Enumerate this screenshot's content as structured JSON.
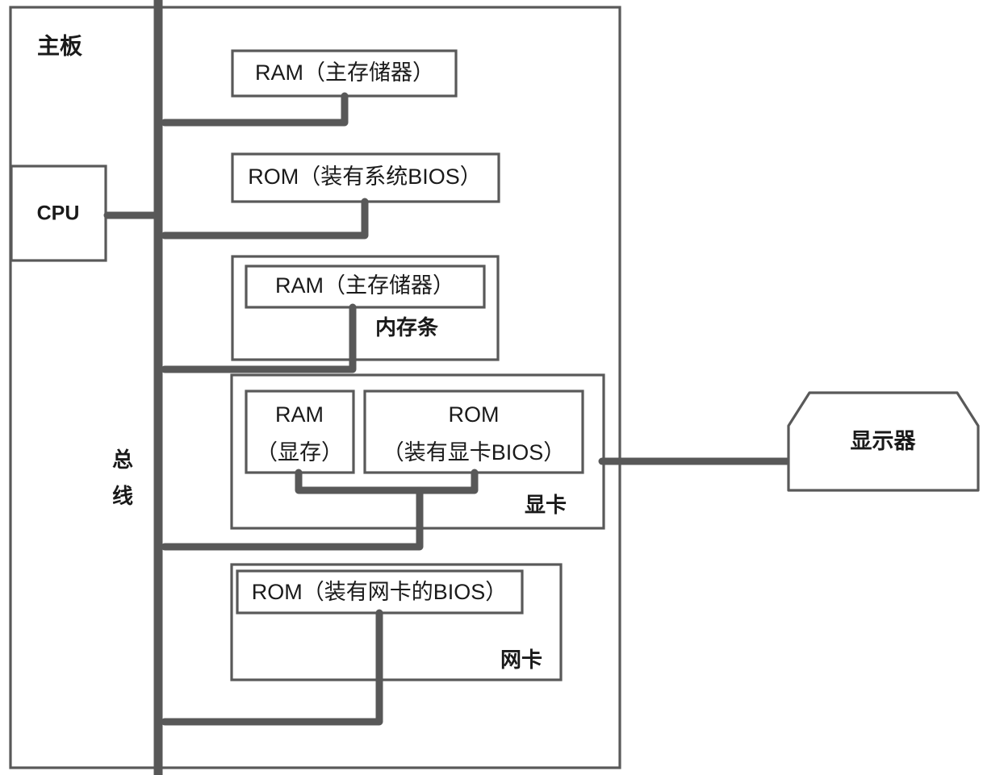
{
  "diagram": {
    "title_motherboard": "主板",
    "bus_label_chars": [
      "总",
      "线"
    ],
    "colors": {
      "line": "#585858",
      "box_border": "#595959",
      "text": "#1a1a1a",
      "background": "#ffffff"
    },
    "nodes": {
      "cpu": {
        "label": "CPU"
      },
      "ram_main_top": {
        "label": "RAM（主存储器）"
      },
      "rom_system_bios": {
        "label": "ROM（装有系统BIOS）"
      },
      "memory_module": {
        "label": "内存条",
        "inner_ram": {
          "label": "RAM（主存储器）"
        }
      },
      "graphics_card": {
        "label": "显卡",
        "inner_ram": {
          "label_line1": "RAM",
          "label_line2": "（显存）"
        },
        "inner_rom": {
          "label_line1": "ROM",
          "label_line2": "（装有显卡BIOS）"
        }
      },
      "network_card": {
        "label": "网卡",
        "inner_rom": {
          "label": "ROM（装有网卡的BIOS）"
        }
      },
      "monitor": {
        "label": "显示器"
      }
    },
    "connections": [
      {
        "from": "cpu",
        "to": "bus"
      },
      {
        "from": "ram_main_top",
        "to": "bus"
      },
      {
        "from": "rom_system_bios",
        "to": "bus"
      },
      {
        "from": "memory_module_ram",
        "to": "bus"
      },
      {
        "from": "graphics_card_ram",
        "to": "graphics_card_junction"
      },
      {
        "from": "graphics_card_rom",
        "to": "graphics_card_junction"
      },
      {
        "from": "graphics_card_junction",
        "to": "bus"
      },
      {
        "from": "graphics_card",
        "to": "monitor"
      },
      {
        "from": "network_card_rom",
        "to": "bus"
      }
    ]
  }
}
